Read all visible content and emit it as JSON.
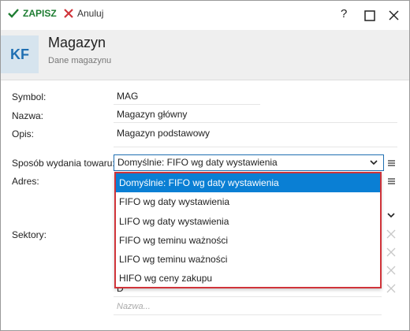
{
  "toolbar": {
    "save_label": "ZAPISZ",
    "cancel_label": "Anuluj",
    "help": "?"
  },
  "header": {
    "badge": "KF",
    "title": "Magazyn",
    "subtitle": "Dane magazynu"
  },
  "form": {
    "symbol_label": "Symbol:",
    "symbol_value": "MAG",
    "name_label": "Nazwa:",
    "name_value": "Magazyn główny",
    "desc_label": "Opis:",
    "desc_value": "Magazyn podstawowy",
    "method_label": "Sposób wydania towaru:",
    "method_value": "Domyślnie: FIFO wg daty wystawienia",
    "address_label": "Adres:",
    "sectors_label": "Sektory:",
    "sector_partial": "D",
    "new_sector_placeholder": "Nazwa..."
  },
  "dropdown": {
    "options": [
      "Domyślnie: FIFO wg daty wystawienia",
      "FIFO wg daty wystawienia",
      "LIFO wg daty wystawienia",
      "FIFO wg teminu ważności",
      "LIFO wg teminu ważności",
      "HIFO wg ceny zakupu"
    ],
    "selected_index": 0
  },
  "colors": {
    "accent": "#0a7fd4",
    "save_green": "#1e7d32",
    "cancel_red": "#d0343a",
    "header_bg": "#efefef"
  },
  "icons": [
    "check-icon",
    "cancel-x-icon",
    "help-icon",
    "maximize-icon",
    "close-icon",
    "chevron-down-icon",
    "menu-icon",
    "remove-x-icon"
  ]
}
